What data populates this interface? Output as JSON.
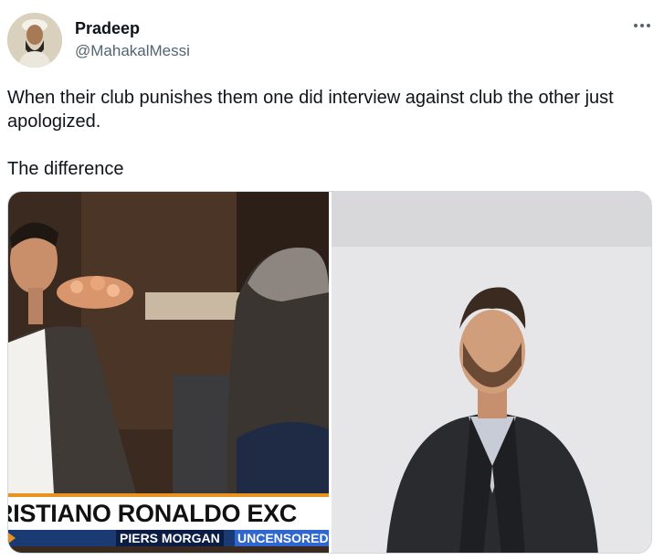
{
  "tweet": {
    "author": {
      "display_name": "Pradeep",
      "handle": "@MahakalMessi",
      "avatar_icon": "avatar-portrait"
    },
    "more_icon": "more-horizontal-icon",
    "text": "When their club punishes them one did interview against club the other just apologized.\n\nThe difference",
    "media": {
      "left_image": {
        "banner_main": "RISTIANO RONALDO EXC",
        "banner_sub1": "PIERS MORGAN",
        "banner_sub2": "UNCENSORED"
      },
      "right_image": {}
    }
  },
  "colors": {
    "text_primary": "#0f1419",
    "text_secondary": "#536471",
    "border": "#cfd9de",
    "banner_orange": "#e89320",
    "banner_navy": "#0c1d45",
    "banner_blue": "#2f66d0"
  }
}
